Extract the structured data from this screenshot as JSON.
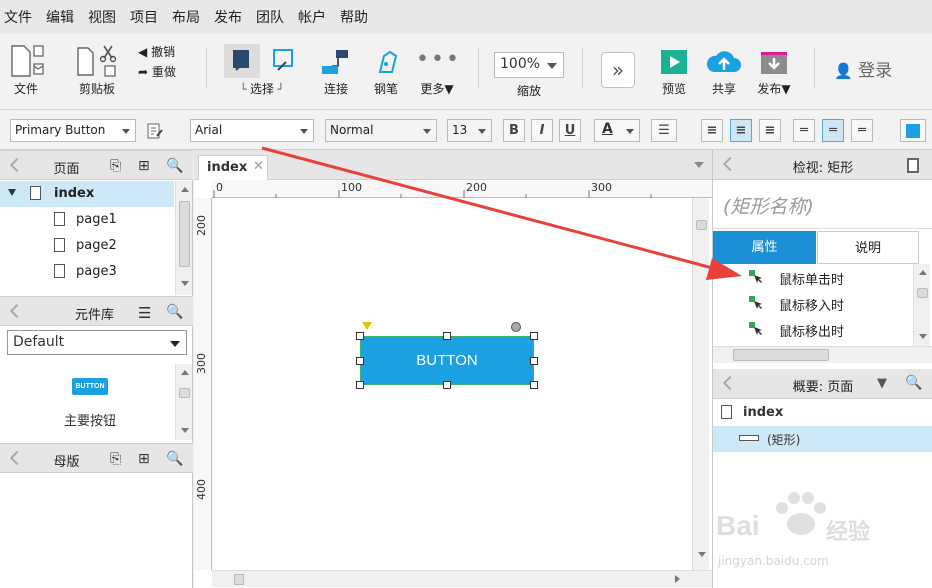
{
  "menu": [
    "文件",
    "编辑",
    "视图",
    "项目",
    "布局",
    "发布",
    "团队",
    "帐户",
    "帮助"
  ],
  "toolbar": {
    "file": "文件",
    "clipboard": "剪贴板",
    "undo": "撤销",
    "redo": "重做",
    "select": "选择",
    "connect": "连接",
    "pen": "钢笔",
    "more": "更多▼",
    "zoom_value": "100%",
    "zoom_label": "缩放",
    "preview": "预览",
    "share": "共享",
    "publish": "发布▼",
    "login": "登录"
  },
  "formatbar": {
    "style": "Primary Button",
    "font": "Arial",
    "weight": "Normal",
    "size": "13",
    "bold": "B",
    "italic": "I",
    "underline": "U",
    "font_color": "A"
  },
  "pages_panel": {
    "title": "页面",
    "root": "index",
    "children": [
      "page1",
      "page2",
      "page3"
    ]
  },
  "library_panel": {
    "title": "元件库",
    "selected": "Default",
    "widget_thumb": "BUTTON",
    "widget_label": "主要按钮"
  },
  "masters_panel": {
    "title": "母版"
  },
  "canvas": {
    "tab": "index",
    "ruler_h": [
      "0",
      "100",
      "200",
      "300"
    ],
    "ruler_v": [
      "200",
      "300",
      "400"
    ],
    "button_text": "BUTTON"
  },
  "inspector": {
    "title": "检视: 矩形",
    "name_placeholder": "(矩形名称)",
    "tab_properties": "属性",
    "tab_notes": "说明",
    "events": [
      "鼠标单击时",
      "鼠标移入时",
      "鼠标移出时"
    ]
  },
  "outline": {
    "title": "概要: 页面",
    "root": "index",
    "item": "(矩形)"
  },
  "watermark": {
    "brand": "Bai",
    "brand2": "经验",
    "url": "jingyan.baidu.com"
  },
  "colors": {
    "accent": "#1ba0e2",
    "arrow": "#e8413a"
  }
}
